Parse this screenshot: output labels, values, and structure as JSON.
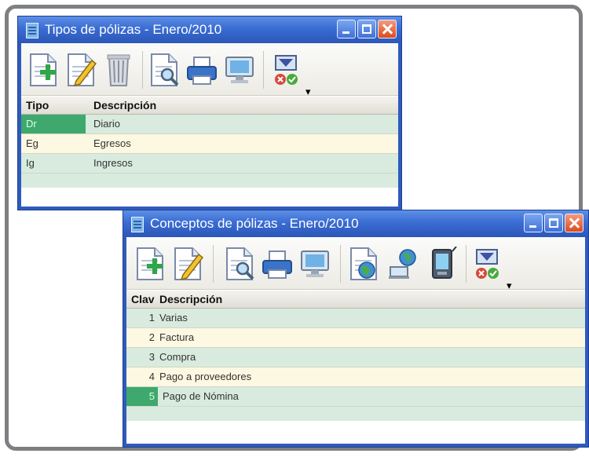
{
  "colors": {
    "title_bar": "#3a6cd3",
    "row_green": "#d8ebde",
    "row_yellow": "#fdf8e2",
    "selection": "#3fa86d"
  },
  "window1": {
    "title": "Tipos de pólizas - Enero/2010",
    "toolbar_icons": [
      "add-record-icon",
      "edit-record-icon",
      "delete-record-icon",
      "print-preview-icon",
      "print-icon",
      "monitor-icon",
      "filter-icon"
    ],
    "columns": {
      "tipo": "Tipo",
      "descripcion": "Descripción"
    },
    "rows": [
      {
        "tipo": "Dr",
        "descripcion": "Diario"
      },
      {
        "tipo": "Eg",
        "descripcion": "Egresos"
      },
      {
        "tipo": "Ig",
        "descripcion": "Ingresos"
      }
    ]
  },
  "window2": {
    "title": "Conceptos de pólizas - Enero/2010",
    "toolbar_icons": [
      "add-record-icon",
      "edit-record-icon",
      "print-preview-icon",
      "print-icon",
      "monitor-icon",
      "globe-icon",
      "network-icon",
      "device-icon",
      "filter-icon"
    ],
    "columns": {
      "clave": "Clav",
      "descripcion": "Descripción"
    },
    "rows": [
      {
        "clave": "1",
        "descripcion": "Varias"
      },
      {
        "clave": "2",
        "descripcion": "Factura"
      },
      {
        "clave": "3",
        "descripcion": "Compra"
      },
      {
        "clave": "4",
        "descripcion": "Pago a proveedores"
      },
      {
        "clave": "5",
        "descripcion": "Pago de Nómina"
      }
    ]
  }
}
